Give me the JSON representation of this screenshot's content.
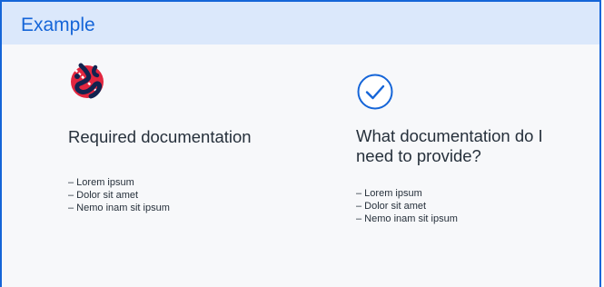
{
  "card": {
    "title": "Example"
  },
  "columns": [
    {
      "icon": "no-entry-icon",
      "heading": "Required documentation",
      "items": [
        "– Lorem ipsum",
        "– Dolor sit amet",
        "– Nemo inam sit ipsum"
      ]
    },
    {
      "icon": "checkmark-circle-icon",
      "heading": "What documentation do I need to provide?",
      "items": [
        "– Lorem ipsum",
        "– Dolor sit amet",
        "– Nemo inam sit ipsum"
      ]
    }
  ],
  "colors": {
    "accent": "#1565d8",
    "header_bg": "#dbe8fb",
    "alert_red": "#e2263f",
    "navy": "#12234f"
  }
}
